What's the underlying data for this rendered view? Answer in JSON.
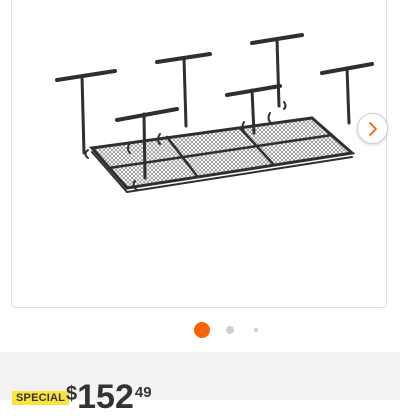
{
  "icons": {
    "next": "chevron-right-icon"
  },
  "carousel": {
    "dots": 3,
    "active_index": 0
  },
  "colors": {
    "accent": "#f96302",
    "badge": "#fbe33a",
    "price_band": "#f3f3f3"
  },
  "price": {
    "badge": "SPECIAL",
    "currency": "$",
    "dollars": "152",
    "cents": "49"
  }
}
